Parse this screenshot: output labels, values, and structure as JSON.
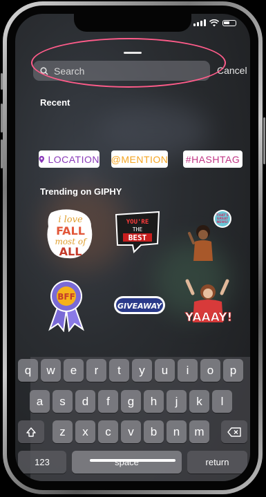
{
  "search": {
    "placeholder": "Search",
    "cancel_label": "Cancel"
  },
  "recent": {
    "title": "Recent",
    "tags": [
      {
        "label": "LOCATION",
        "color": "#8a3ab9"
      },
      {
        "label": "@MENTION",
        "color": "#f5a623"
      },
      {
        "label": "#HASHTAG",
        "color": "#c13584"
      }
    ]
  },
  "trending": {
    "title": "Trending on GIPHY",
    "stickers": [
      {
        "name": "i-love-fall-sticker",
        "text": [
          "i love",
          "FALL",
          "most of",
          "ALL"
        ]
      },
      {
        "name": "youre-the-best-sticker",
        "text": [
          "YOU'RE",
          "THE",
          "BEST"
        ]
      },
      {
        "name": "thats-great-news-sticker",
        "text": [
          "THAT'S",
          "GREAT",
          "NEWS!"
        ]
      },
      {
        "name": "bff-ribbon-sticker",
        "text": [
          "BFF"
        ]
      },
      {
        "name": "giveaway-sticker",
        "text": [
          "GIVEAWAY"
        ]
      },
      {
        "name": "yaaay-sticker",
        "text": [
          "YAAAY!"
        ]
      }
    ]
  },
  "keyboard": {
    "row1": [
      "q",
      "w",
      "e",
      "r",
      "t",
      "y",
      "u",
      "i",
      "o",
      "p"
    ],
    "row2": [
      "a",
      "s",
      "d",
      "f",
      "g",
      "h",
      "j",
      "k",
      "l"
    ],
    "row3": [
      "z",
      "x",
      "c",
      "v",
      "b",
      "n",
      "m"
    ],
    "numbers_label": "123",
    "space_label": "space",
    "return_label": "return"
  },
  "colors": {
    "highlight_oval": "#ff5c8a",
    "location_tag": "#8a3ab9",
    "mention_tag": "#f5a623",
    "hashtag_tag": "#c13584"
  }
}
